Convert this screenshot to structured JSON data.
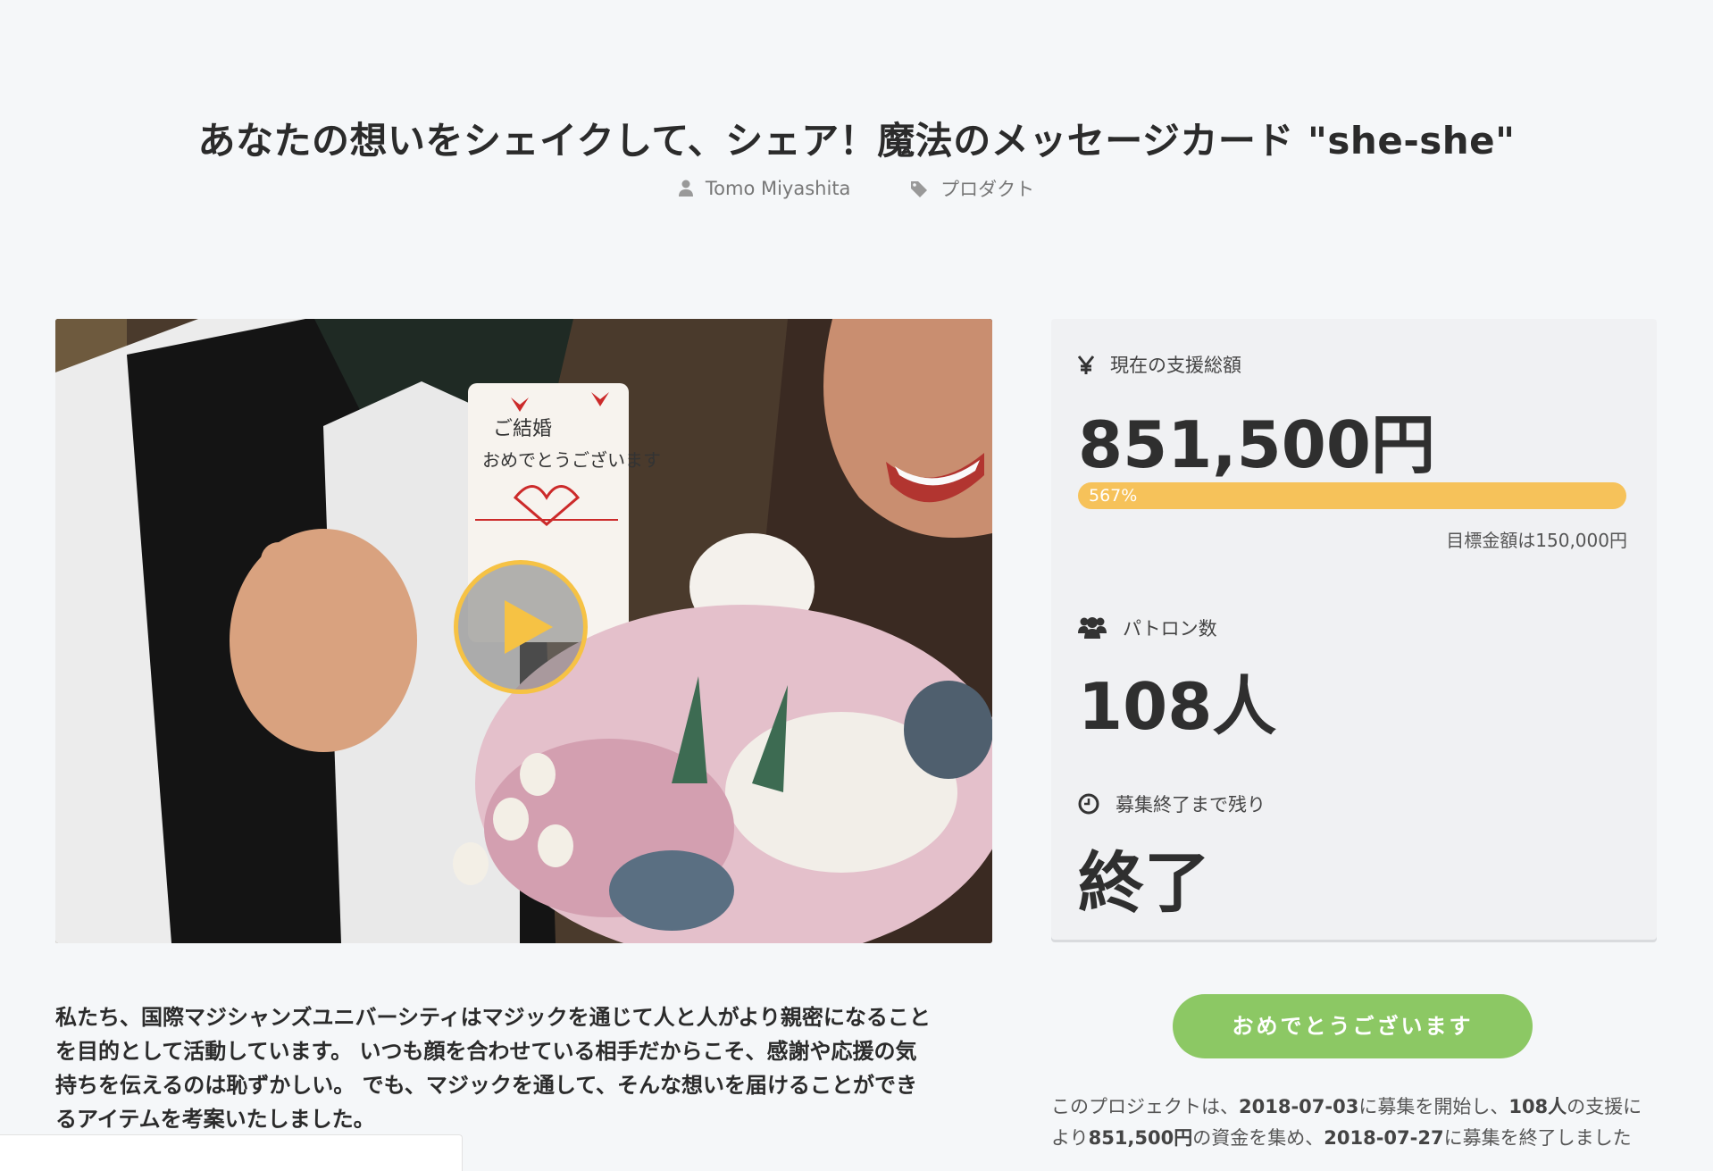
{
  "page": {
    "title": "あなたの想いをシェイクして、シェア！魔法のメッセージカード \"she-she\"",
    "author": "Tomo Miyashita",
    "category": "プロダクト"
  },
  "video": {
    "card_text_1": "ご結婚",
    "card_text_2": "おめでとうございます",
    "play_icon": "play-icon"
  },
  "stats": {
    "amount_label": "現在の支援総額",
    "amount_value": "851,500円",
    "progress_percent": 567,
    "progress_label": "567%",
    "goal_text": "目標金額は150,000円",
    "patrons_label": "パトロン数",
    "patrons_value": "108人",
    "remaining_label": "募集終了まで残り",
    "remaining_value": "終了"
  },
  "cta": {
    "label": "おめでとうございます"
  },
  "summary": {
    "p1": "このプロジェクトは、",
    "start_date": "2018-07-03",
    "p2": "に募集を開始し、",
    "patrons": "108人",
    "p3": "の支援に",
    "p4": "より",
    "amount": "851,500円",
    "p5": "の資金を集め、",
    "end_date": "2018-07-27",
    "p6": "に募集を終了しました"
  },
  "description": {
    "line1": "私たち、国際マジシャンズユニバーシティはマジックを通じて人と人がより親密になること",
    "line2": "を目的として活動しています。 いつも顔を合わせている相手だからこそ、感謝や応援の気",
    "line3": "持ちを伝えるのは恥ずかしい。 でも、マジックを通して、そんな想いを届けることができ",
    "line4": "るアイテムを考案いたしました。"
  },
  "colors": {
    "background": "#f5f7f9",
    "progress": "#f6c25a",
    "cta": "#8cc864",
    "play_ring": "#f6c244"
  }
}
